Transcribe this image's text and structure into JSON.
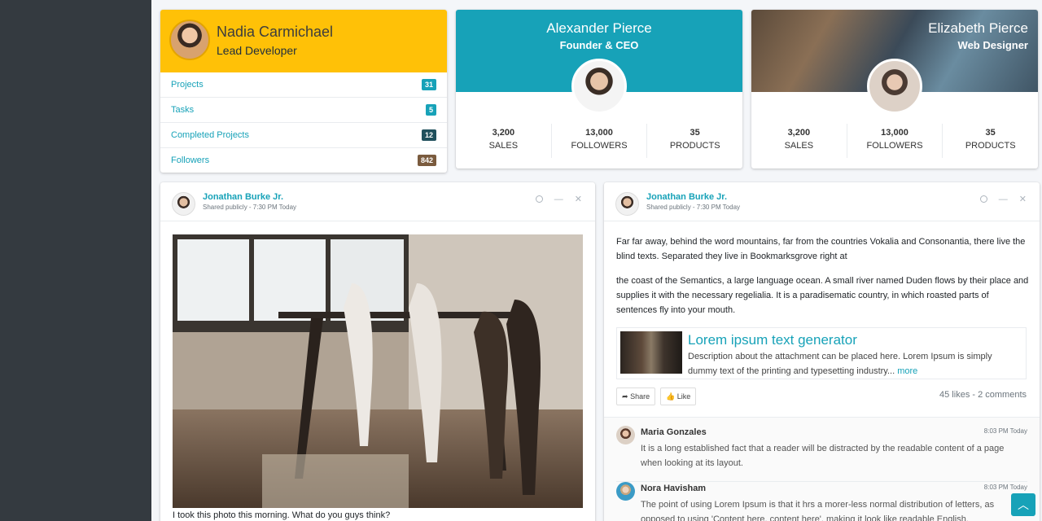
{
  "widget_user1": {
    "name": "Nadia Carmichael",
    "role": "Lead Developer",
    "header_color": "#ffc107",
    "items": [
      {
        "label": "Projects",
        "badge": "31",
        "color": "#17a2b8"
      },
      {
        "label": "Tasks",
        "badge": "5",
        "color": "#17a2b8"
      },
      {
        "label": "Completed Projects",
        "badge": "12",
        "color": "#20505c"
      },
      {
        "label": "Followers",
        "badge": "842",
        "color": "#7a5b3e"
      }
    ]
  },
  "widget_user2": {
    "name": "Alexander Pierce",
    "role": "Founder & CEO",
    "header_color": "#17a2b8",
    "stats": [
      {
        "value": "3,200",
        "label": "SALES"
      },
      {
        "value": "13,000",
        "label": "FOLLOWERS"
      },
      {
        "value": "35",
        "label": "PRODUCTS"
      }
    ]
  },
  "widget_user3": {
    "name": "Elizabeth Pierce",
    "role": "Web Designer",
    "stats": [
      {
        "value": "3,200",
        "label": "SALES"
      },
      {
        "value": "13,000",
        "label": "FOLLOWERS"
      },
      {
        "value": "35",
        "label": "PRODUCTS"
      }
    ]
  },
  "post1": {
    "author": "Jonathan Burke Jr.",
    "meta": "Shared publicly - 7:30 PM Today",
    "caption": "I took this photo this morning. What do you guys think?"
  },
  "post2": {
    "author": "Jonathan Burke Jr.",
    "meta": "Shared publicly - 7:30 PM Today",
    "paragraph1": "Far far away, behind the word mountains, far from the countries Vokalia and Consonantia, there live the blind texts. Separated they live in Bookmarksgrove right at",
    "paragraph2": "the coast of the Semantics, a large language ocean. A small river named Duden flows by their place and supplies it with the necessary regelialia. It is a paradisematic country, in which roasted parts of sentences fly into your mouth.",
    "attachment": {
      "title": "Lorem ipsum text generator",
      "description": "Description about the attachment can be placed here. Lorem Ipsum is simply dummy text of the printing and typesetting industry...",
      "more": "more"
    },
    "share_label": "Share",
    "like_label": "Like",
    "counts": "45 likes - 2 comments",
    "comments": [
      {
        "name": "Maria Gonzales",
        "time": "8:03 PM Today",
        "text": "It is a long established fact that a reader will be distracted by the readable content of a page when looking at its layout."
      },
      {
        "name": "Nora Havisham",
        "time": "8:03 PM Today",
        "text": "The point of using Lorem Ipsum is that it hrs a morer-less normal distribution of letters, as opposed to using 'Content here, content here', making it look like readable English."
      }
    ]
  },
  "icons": {
    "collapse": "minus-icon",
    "remove": "times-icon",
    "mark_read": "circle-icon",
    "back_to_top": "chevron-up-icon"
  }
}
